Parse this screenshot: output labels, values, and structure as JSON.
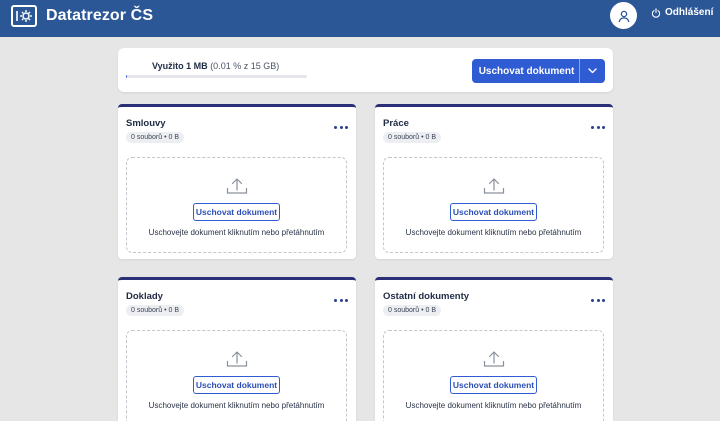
{
  "header": {
    "app_title": "Datatrezor ČS",
    "logo_icon": "safe-icon",
    "avatar_icon": "user-icon",
    "logout_icon": "power-icon",
    "logout_label": "Odhlášení",
    "bg_color": "#2b5797"
  },
  "usage": {
    "used_label": "Využito 1 MB",
    "detail": "(0.01 % z 15 GB)",
    "used_fraction": 0.0001,
    "upload_button": "Uschovat dokument",
    "accent": "#2f5bd3"
  },
  "folders": [
    {
      "title": "Smlouvy",
      "badge": "0 souborů • 0 B",
      "upload_button": "Uschovat dokument",
      "hint": "Uschovejte dokument kliknutím nebo přetáhnutím"
    },
    {
      "title": "Práce",
      "badge": "0 souborů • 0 B",
      "upload_button": "Uschovat dokument",
      "hint": "Uschovejte dokument kliknutím nebo přetáhnutím"
    },
    {
      "title": "Doklady",
      "badge": "0 souborů • 0 B",
      "upload_button": "Uschovat dokument",
      "hint": "Uschovejte dokument kliknutím nebo přetáhnutím"
    },
    {
      "title": "Ostatní dokumenty",
      "badge": "0 souborů • 0 B",
      "upload_button": "Uschovat dokument",
      "hint": "Uschovejte dokument kliknutím nebo přetáhnutím"
    }
  ]
}
